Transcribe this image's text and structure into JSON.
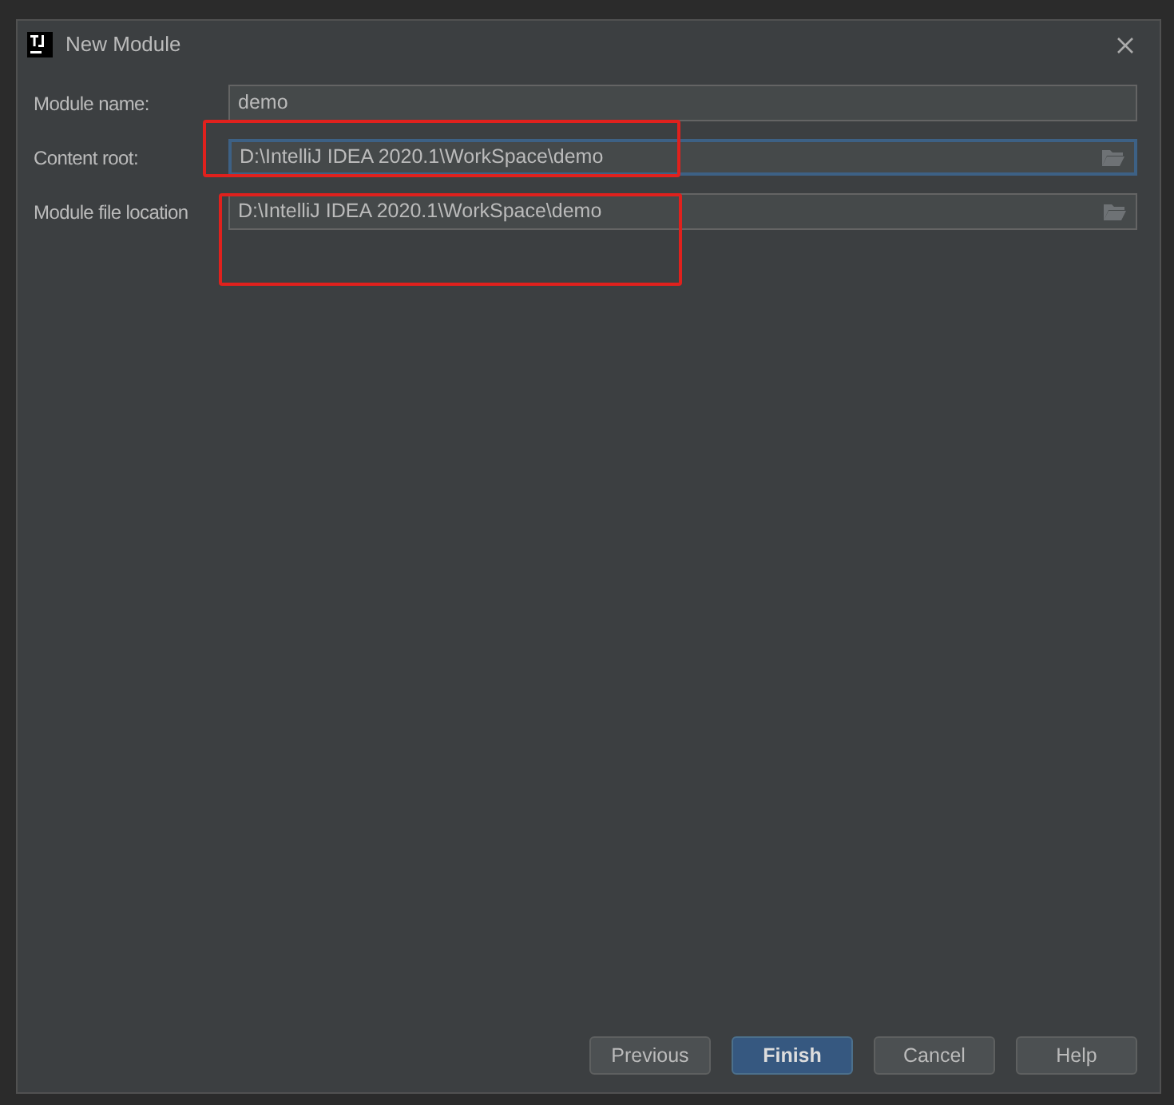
{
  "window": {
    "title": "New Module"
  },
  "fields": [
    {
      "label": "Module name:",
      "value": "demo",
      "focused": false,
      "browse": false
    },
    {
      "label": "Content root:",
      "value": "D:\\IntelliJ IDEA 2020.1\\WorkSpace\\demo",
      "focused": true,
      "browse": true
    },
    {
      "label": "Module file location",
      "value": "D:\\IntelliJ IDEA 2020.1\\WorkSpace\\demo",
      "focused": false,
      "browse": true
    }
  ],
  "buttons": [
    {
      "label": "Previous",
      "default": false
    },
    {
      "label": "Finish",
      "default": true
    },
    {
      "label": "Cancel",
      "default": false
    },
    {
      "label": "Help",
      "default": false
    }
  ]
}
